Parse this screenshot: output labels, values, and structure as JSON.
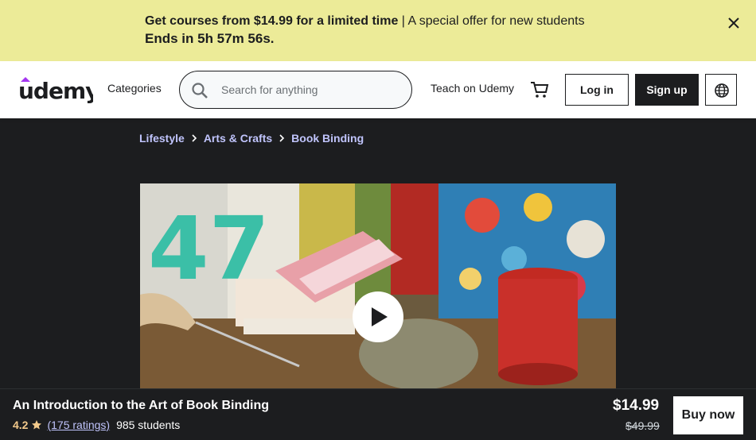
{
  "promo": {
    "headline": "Get courses from $14.99 for a limited time",
    "separator": "|",
    "subline": "A special offer for new students",
    "countdown": "Ends in 5h 57m 56s."
  },
  "header": {
    "logo_text": "udemy",
    "categories": "Categories",
    "search_placeholder": "Search for anything",
    "teach": "Teach on Udemy",
    "login": "Log in",
    "signup": "Sign up"
  },
  "breadcrumb": [
    "Lifestyle",
    "Arts & Crafts",
    "Book Binding"
  ],
  "buybar": {
    "title": "An Introduction to the Art of Book Binding",
    "rating": "4.2",
    "ratings_count": "(175 ratings)",
    "students": "985 students",
    "price": "$14.99",
    "original_price": "$49.99",
    "buy_label": "Buy now"
  },
  "colors": {
    "banner": "#eceb98",
    "dark": "#1c1d1f",
    "link": "#c0c4fc",
    "rating": "#f3ca8c",
    "brand_accent": "#a435f0"
  },
  "icons": [
    "close-icon",
    "search-icon",
    "cart-icon",
    "globe-icon",
    "chevron-right-icon",
    "play-icon",
    "star-icon"
  ]
}
